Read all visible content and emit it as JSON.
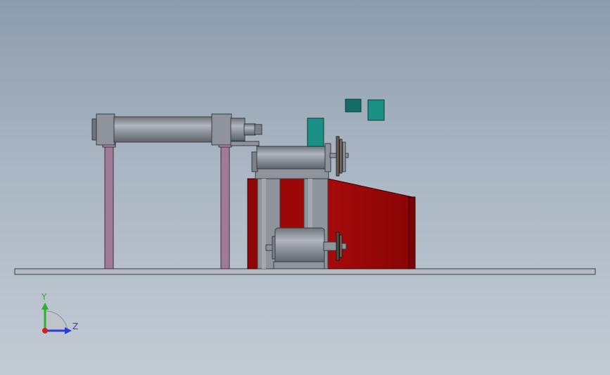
{
  "view": {
    "background_top": "#8d9cad",
    "background_bottom": "#c3cbd4"
  },
  "model": {
    "part_colors": {
      "steel": "#8e939c",
      "steel_dark": "#5d626a",
      "housing_red": "#9b0707",
      "housing_red_dark": "#6e0404",
      "support_post": "#a07a96",
      "teal_block": "#1b9186",
      "teal_block_dark": "#156b66",
      "base_plate": "#b7bcc3"
    }
  },
  "triad": {
    "y_label": "Y",
    "z_label": "Z",
    "y_color": "#2bb12b",
    "z_color": "#2b3bd6",
    "x_color": "#d42020"
  }
}
